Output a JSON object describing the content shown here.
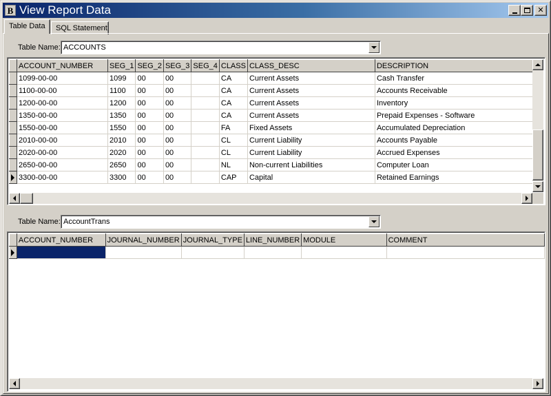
{
  "window": {
    "title": "View Report Data",
    "icon_letter": "B",
    "close_glyph": "✕"
  },
  "tabs": [
    {
      "label": "Table Data",
      "active": true
    },
    {
      "label": "SQL Statement",
      "active": false
    }
  ],
  "top_panel": {
    "table_name_label": "Table Name:",
    "table_name_value": "ACCOUNTS",
    "columns": [
      "ACCOUNT_NUMBER",
      "SEG_1",
      "SEG_2",
      "SEG_3",
      "SEG_4",
      "CLASS",
      "CLASS_DESC",
      "DESCRIPTION"
    ],
    "rows": [
      [
        "1099-00-00",
        "1099",
        "00",
        "00",
        "",
        "CA",
        "Current Assets",
        "Cash Transfer"
      ],
      [
        "1100-00-00",
        "1100",
        "00",
        "00",
        "",
        "CA",
        "Current Assets",
        "Accounts Receivable"
      ],
      [
        "1200-00-00",
        "1200",
        "00",
        "00",
        "",
        "CA",
        "Current Assets",
        "Inventory"
      ],
      [
        "1350-00-00",
        "1350",
        "00",
        "00",
        "",
        "CA",
        "Current Assets",
        "Prepaid Expenses - Software"
      ],
      [
        "1550-00-00",
        "1550",
        "00",
        "00",
        "",
        "FA",
        "Fixed Assets",
        "Accumulated Depreciation"
      ],
      [
        "2010-00-00",
        "2010",
        "00",
        "00",
        "",
        "CL",
        "Current Liability",
        "Accounts Payable"
      ],
      [
        "2020-00-00",
        "2020",
        "00",
        "00",
        "",
        "CL",
        "Current Liability",
        "Accrued Expenses"
      ],
      [
        "2650-00-00",
        "2650",
        "00",
        "00",
        "",
        "NL",
        "Non-current Liabilities",
        "Computer Loan"
      ],
      [
        "3300-00-00",
        "3300",
        "00",
        "00",
        "",
        "CAP",
        "Capital",
        "Retained Earnings"
      ]
    ],
    "current_row_index": 8
  },
  "bottom_panel": {
    "table_name_label": "Table Name:",
    "table_name_value": "AccountTrans",
    "columns": [
      "ACCOUNT_NUMBER",
      "JOURNAL_NUMBER",
      "JOURNAL_TYPE",
      "LINE_NUMBER",
      "MODULE",
      "COMMENT"
    ],
    "rows": [
      [
        "",
        "",
        "",
        "",
        "",
        ""
      ]
    ]
  },
  "colors": {
    "title_bar_start": "#0a246a",
    "title_bar_end": "#a6caf0",
    "face": "#d4d0c8",
    "selection": "#0a246a"
  }
}
